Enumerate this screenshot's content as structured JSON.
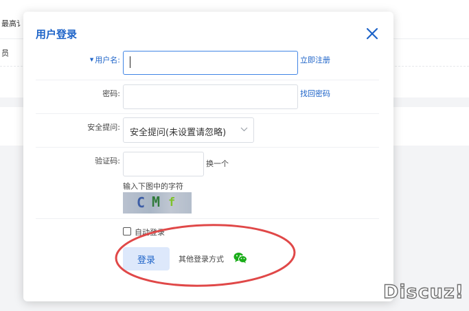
{
  "background": {
    "text_1": "最高讠",
    "text_2": "员"
  },
  "modal": {
    "title": "用户登录",
    "close_icon": "close-icon"
  },
  "form": {
    "username_label": "用户名:",
    "username_value": "",
    "register_link": "立即注册",
    "password_label": "密码:",
    "password_value": "",
    "recover_link": "找回密码",
    "question_label": "安全提问:",
    "question_value": "安全提问(未设置请忽略)",
    "captcha_label": "验证码:",
    "captcha_value": "",
    "refresh_link": "换一个",
    "captcha_hint": "输入下图中的字符",
    "captcha_chars": [
      "C",
      "M",
      "f"
    ],
    "auto_login_label": "自动登录",
    "auto_login_checked": false,
    "login_button": "登录",
    "other_login": "其他登录方式",
    "wechat_icon": "wechat-icon"
  },
  "watermark": "Discuz!",
  "colors": {
    "accent": "#1d63c8",
    "login_button_bg": "#dde8fb",
    "wechat_green": "#1aad19",
    "annotation_red": "#e04848"
  }
}
